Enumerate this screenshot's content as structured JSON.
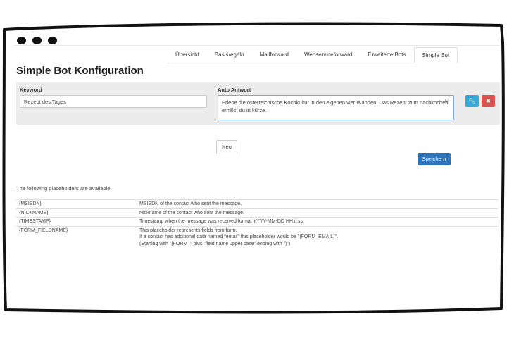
{
  "tabs": [
    {
      "label": "Übersicht",
      "active": false
    },
    {
      "label": "Basisregeln",
      "active": false
    },
    {
      "label": "Mailforward",
      "active": false
    },
    {
      "label": "Webserviceforward",
      "active": false
    },
    {
      "label": "Erweiterte Bots",
      "active": false
    },
    {
      "label": "Simple Bot",
      "active": true
    }
  ],
  "page": {
    "title": "Simple Bot Konfiguration"
  },
  "form": {
    "keyword_label": "Keyword",
    "keyword_value": "Rezept des Tages",
    "answer_label": "Auto Antwort",
    "answer_value": "Erlebe die österreichische Kochkultur in den eigenen vier Wänden. Das Rezept zum nachkochen erhälst du in kürze.",
    "emoji_icon": "smiley-icon",
    "edit_icon": "wrench-icon",
    "delete_icon": "close-icon"
  },
  "buttons": {
    "new_label": "Neu",
    "save_label": "Speichern"
  },
  "colors": {
    "save": "#2f73b8",
    "edit": "#36a9d6",
    "delete": "#d9534f",
    "panel": "#ececec"
  },
  "placeholders": {
    "intro": "The following placeholders are available:",
    "rows": [
      {
        "key": "{MSISDN}",
        "lines": [
          "MSISDN of the contact who sent the message."
        ]
      },
      {
        "key": "{NICKNAME}",
        "lines": [
          "Nickname of the contact who sent the message."
        ]
      },
      {
        "key": "{TIMESTAMP}",
        "lines": [
          "Timestamp when the message was received format YYYY-MM-DD HH:ii:ss"
        ]
      },
      {
        "key": "{FORM_FIELDNAME}",
        "lines": [
          "This placeholder represents fields from form.",
          "If a contact has additional data named \"email\" this placeholder would be \"{FORM_EMAIL}\".",
          "(Starting with \"{FORM_\" plus \"field name upper case\" ending with \"}\")"
        ]
      }
    ]
  }
}
